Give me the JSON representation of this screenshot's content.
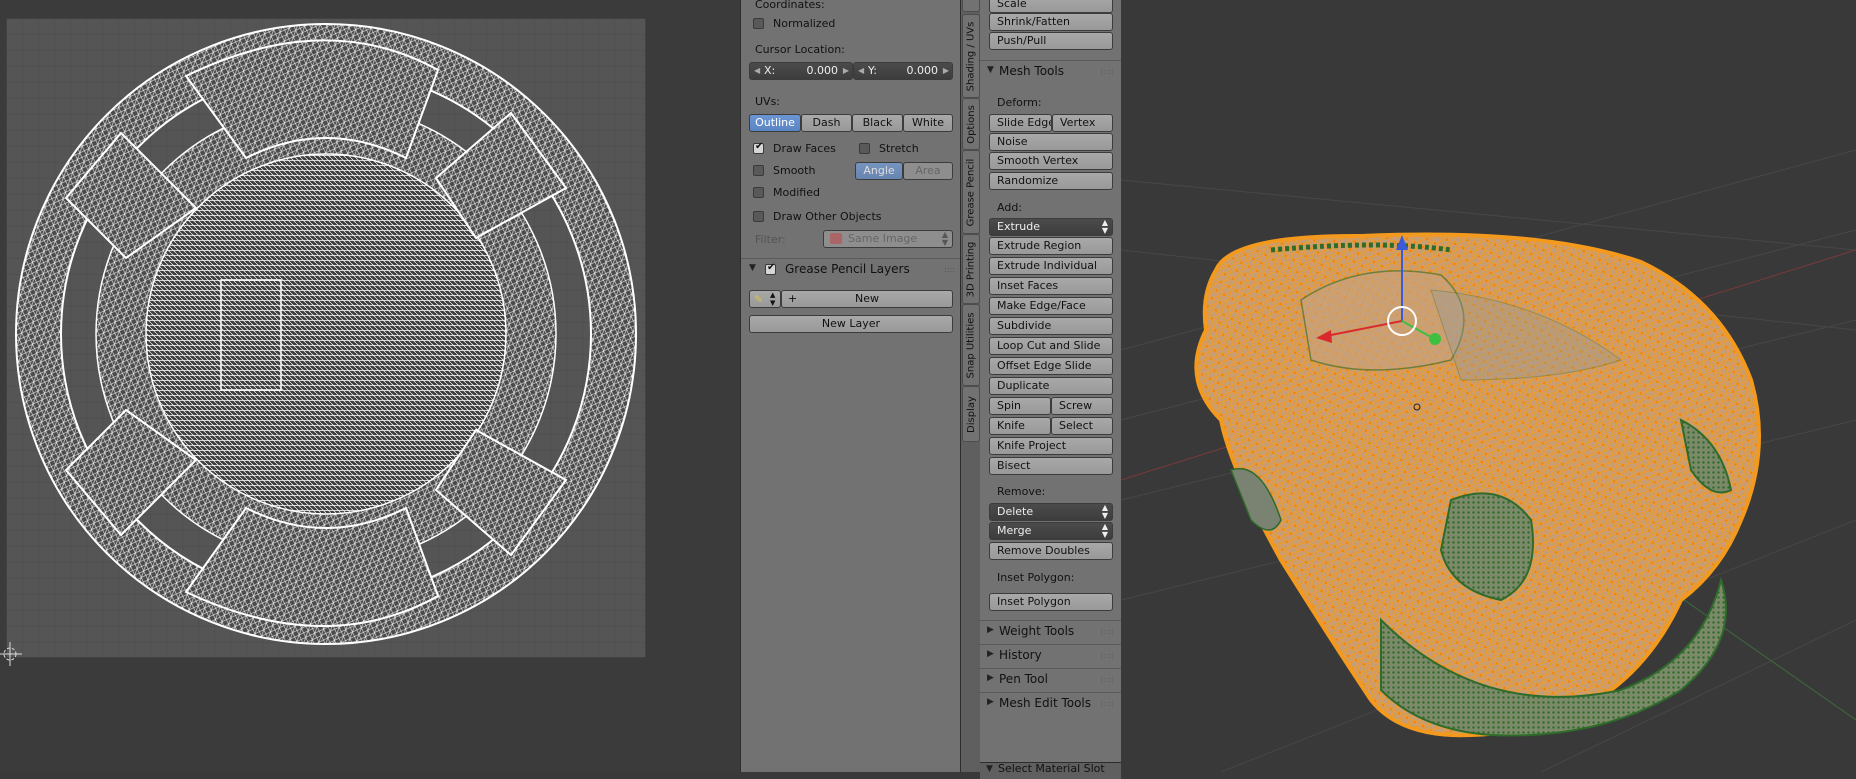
{
  "uv_props": {
    "coordinates_label": "Coordinates:",
    "normalized_label": "Normalized",
    "cursor_location_label": "Cursor Location:",
    "cursor_x_label": "X:",
    "cursor_x_value": "0.000",
    "cursor_y_label": "Y:",
    "cursor_y_value": "0.000",
    "uvs_label": "UVs:",
    "uv_modes": [
      "Outline",
      "Dash",
      "Black",
      "White"
    ],
    "draw_faces_label": "Draw Faces",
    "stretch_label": "Stretch",
    "smooth_label": "Smooth",
    "angle_label": "Angle",
    "area_label": "Area",
    "modified_label": "Modified",
    "draw_other_objects_label": "Draw Other Objects",
    "filter_label": "Filter:",
    "filter_value": "Same Image",
    "grease_pencil_layers_label": "Grease Pencil Layers",
    "new_label": "New",
    "new_layer_label": "New Layer"
  },
  "vtabs": [
    "Shading / UVs",
    "Options",
    "Grease Pencil",
    "3D Printing",
    "Snap Utilities",
    "Display"
  ],
  "tools": {
    "scale_label": "Scale",
    "shrink_fatten_label": "Shrink/Fatten",
    "push_pull_label": "Push/Pull",
    "mesh_tools_label": "Mesh Tools",
    "deform_label": "Deform:",
    "slide_edge_label": "Slide Edge",
    "vertex_label": "Vertex",
    "noise_label": "Noise",
    "smooth_vertex_label": "Smooth Vertex",
    "randomize_label": "Randomize",
    "add_label": "Add:",
    "extrude_label": "Extrude",
    "extrude_region_label": "Extrude Region",
    "extrude_individual_label": "Extrude Individual",
    "inset_faces_label": "Inset Faces",
    "make_edge_face_label": "Make Edge/Face",
    "subdivide_label": "Subdivide",
    "loop_cut_slide_label": "Loop Cut and Slide",
    "offset_edge_slide_label": "Offset Edge Slide",
    "duplicate_label": "Duplicate",
    "spin_label": "Spin",
    "screw_label": "Screw",
    "knife_label": "Knife",
    "select_label": "Select",
    "knife_project_label": "Knife Project",
    "bisect_label": "Bisect",
    "remove_label": "Remove:",
    "delete_label": "Delete",
    "merge_label": "Merge",
    "remove_doubles_label": "Remove Doubles",
    "inset_polygon_label": "Inset Polygon:",
    "inset_polygon_button_label": "Inset Polygon",
    "weight_tools_label": "Weight Tools",
    "history_label": "History",
    "pen_tool_label": "Pen Tool",
    "mesh_edit_tools_label": "Mesh Edit Tools",
    "select_material_slot_label": "Select Material Slot"
  },
  "colors": {
    "mesh_selected": "#f39a1e",
    "mesh_unselected": "#2f6b2a",
    "uv_button_active": "#5b84c4",
    "panel_bg": "#727272"
  }
}
